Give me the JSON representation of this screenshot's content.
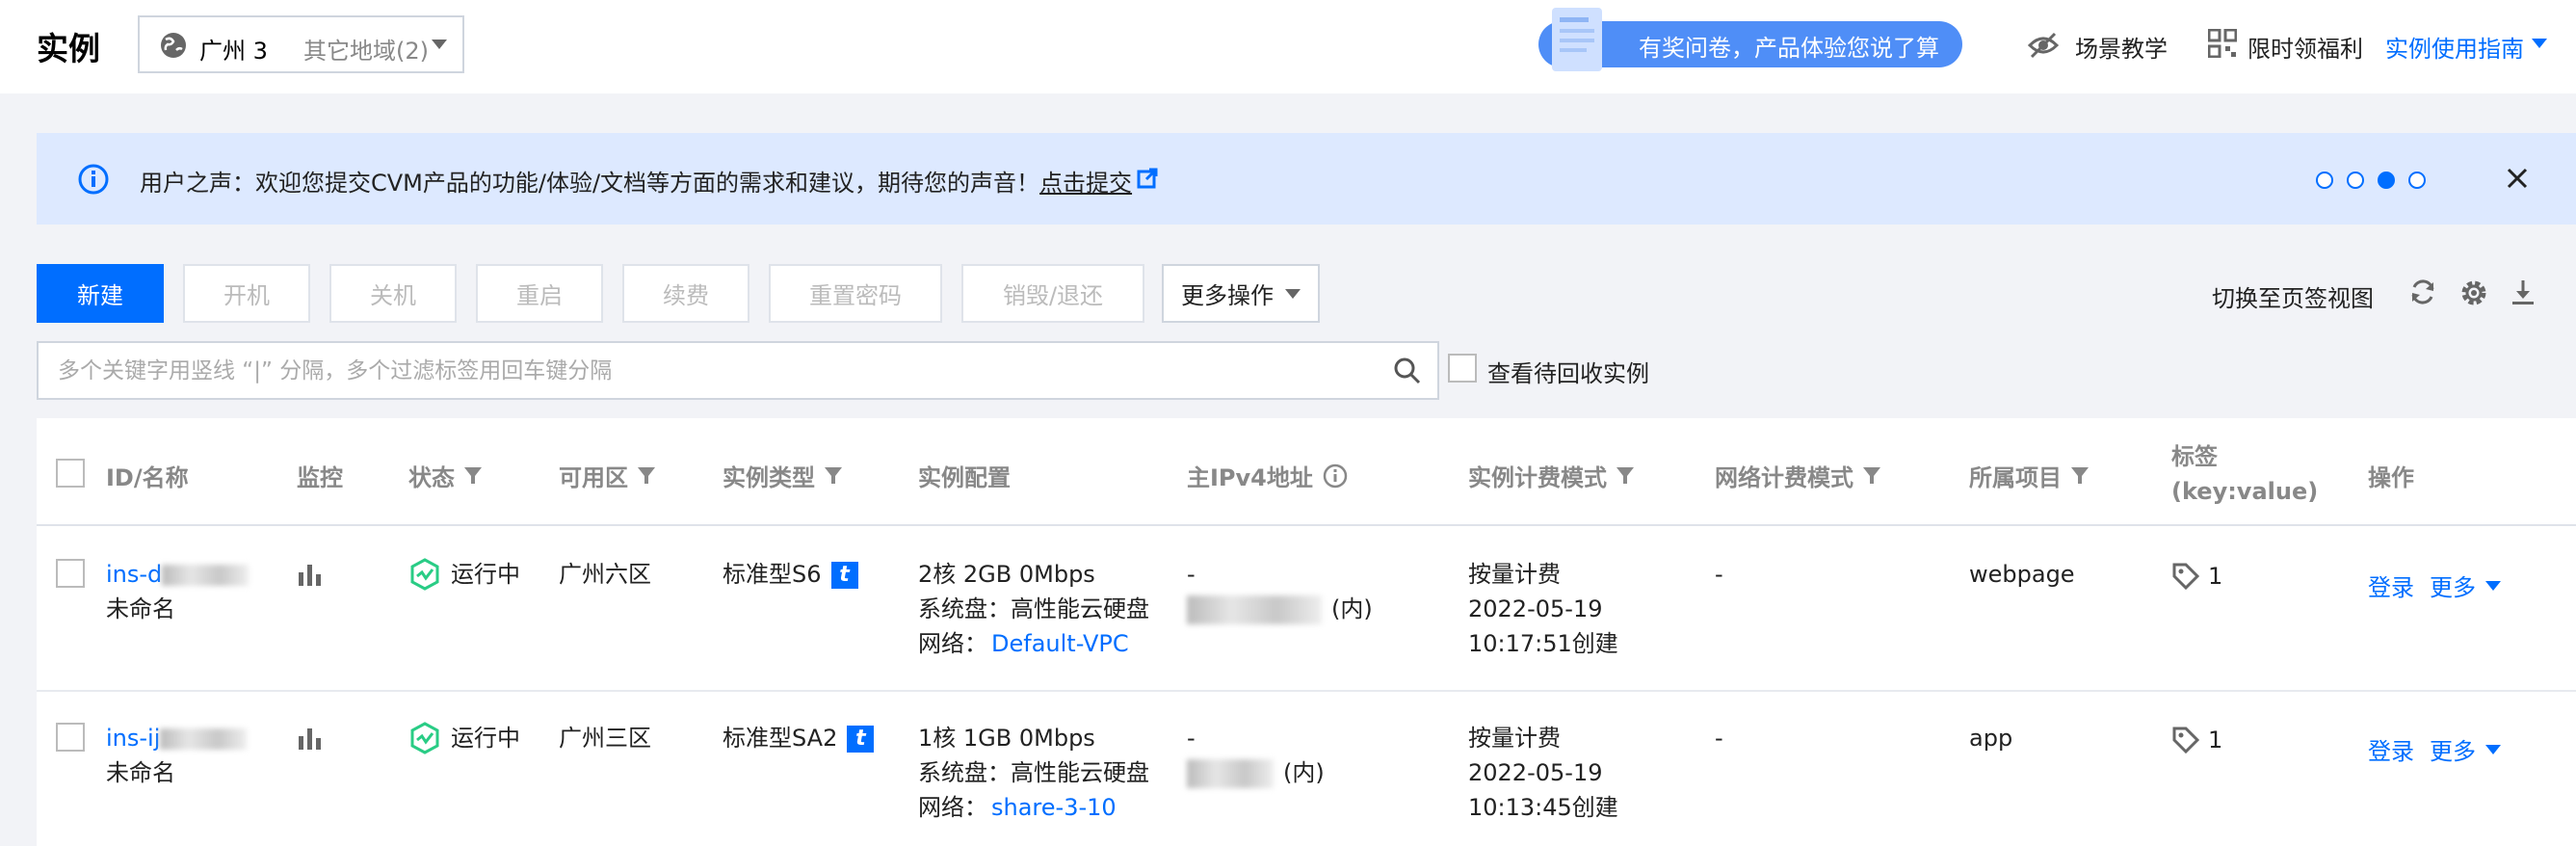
{
  "header": {
    "title": "实例",
    "region_current": "广州 3",
    "region_others": "其它地域(2)",
    "survey_text": "有奖问卷，产品体验您说了算",
    "scene_label": "场景教学",
    "benefit_label": "限时领福利",
    "guide_label": "实例使用指南"
  },
  "notice": {
    "text": "用户之声：欢迎您提交CVM产品的功能/体验/文档等方面的需求和建议，期待您的声音！",
    "link_text": "点击提交",
    "carousel_total": 4,
    "carousel_active": 3
  },
  "toolbar": {
    "new_label": "新建",
    "start_label": "开机",
    "stop_label": "关机",
    "restart_label": "重启",
    "renew_label": "续费",
    "reset_password_label": "重置密码",
    "destroy_label": "销毁/退还",
    "more_label": "更多操作",
    "switch_view_label": "切换至页签视图"
  },
  "search": {
    "placeholder": "多个关键字用竖线 “|” 分隔，多个过滤标签用回车键分隔",
    "recycle_label": "查看待回收实例"
  },
  "table": {
    "columns": {
      "id_name": "ID/名称",
      "monitor": "监控",
      "status": "状态",
      "zone": "可用区",
      "instance_type": "实例类型",
      "config": "实例配置",
      "ipv4": "主IPv4地址",
      "billing": "实例计费模式",
      "net_billing": "网络计费模式",
      "project": "所属项目",
      "tag_line1": "标签",
      "tag_line2": "(key:value)",
      "ops": "操作"
    },
    "rows": [
      {
        "id": "ins-d",
        "name": "未命名",
        "status": "运行中",
        "zone": "广州六区",
        "type": "标准型S6",
        "config_line1": "2核 2GB 0Mbps",
        "config_line2": "系统盘：高性能云硬盘",
        "net_label": "网络：",
        "net_value": "Default-VPC",
        "ip_public": "-",
        "ip_private_suffix": "(内)",
        "billing_line1": "按量计费",
        "billing_line2": "2022-05-19",
        "billing_line3": "10:17:51创建",
        "net_billing": "-",
        "project": "webpage",
        "tag_count": "1",
        "op_login": "登录",
        "op_more": "更多"
      },
      {
        "id": "ins-ij",
        "name": "未命名",
        "status": "运行中",
        "zone": "广州三区",
        "type": "标准型SA2",
        "config_line1": "1核 1GB 0Mbps",
        "config_line2": "系统盘：高性能云硬盘",
        "net_label": "网络：",
        "net_value": "share-3-10",
        "ip_public": "-",
        "ip_private_suffix": "(内)",
        "billing_line1": "按量计费",
        "billing_line2": "2022-05-19",
        "billing_line3": "10:13:45创建",
        "net_billing": "-",
        "project": "app",
        "tag_count": "1",
        "op_login": "登录",
        "op_more": "更多"
      }
    ]
  },
  "colors": {
    "primary": "#006eff",
    "notice_bg": "#dde9ff",
    "page_bg": "#f2f3f7",
    "running": "#29cc85"
  }
}
